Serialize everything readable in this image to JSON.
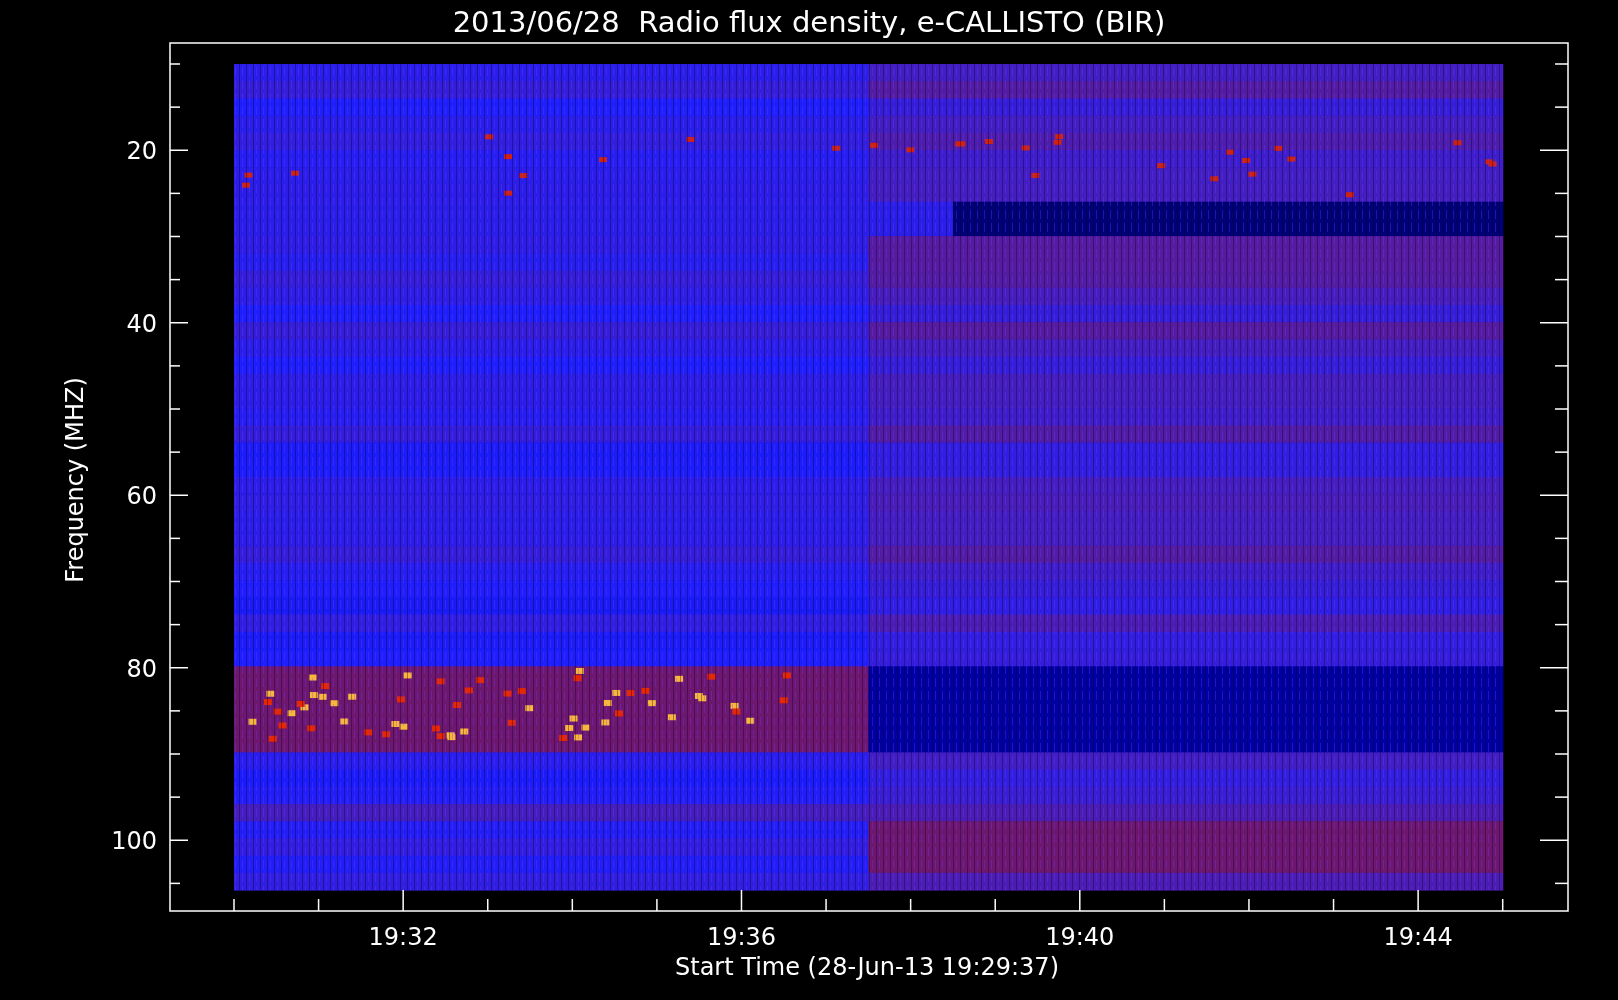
{
  "title": "2013/06/28  Radio flux density, e-CALLISTO (BIR)",
  "ylabel": "Frequency (MHZ)",
  "xlabel": "Start Time (28-Jun-13 19:29:37)",
  "yticks": [
    "20",
    "40",
    "60",
    "80",
    "100"
  ],
  "xticks": [
    "19:32",
    "19:36",
    "19:40",
    "19:44"
  ]
}
